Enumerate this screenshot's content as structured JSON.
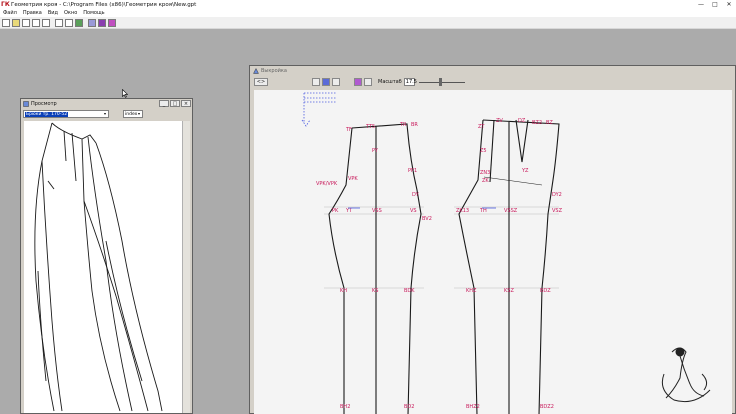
{
  "window": {
    "title": "Геометрия кроя - C:\\Program Files (x86)\\Геометрия кроя\\New.gpt",
    "controls": [
      "—",
      "□",
      "✕"
    ]
  },
  "menu": {
    "items": [
      "Файл",
      "Правка",
      "Вид",
      "Окно",
      "Помощь"
    ]
  },
  "preview": {
    "title": "Просмотр",
    "select_value": "Брюки тр. 170-52",
    "second_value": "index",
    "controls": [
      "_",
      "□",
      "×"
    ]
  },
  "pattern": {
    "title": "Выкройка",
    "nav_label": "<>",
    "zoom_label": "Масштаб",
    "zoom_value": "17.5",
    "zoom_level": 0.45,
    "labels": {
      "front": {
        "top_left": "TF",
        "top_mid": "TT5",
        "top_right": "TR",
        "top_right2": "BR",
        "center_right": "PY",
        "side_right": "PP1",
        "hip_left": "VPK",
        "hip_note": "VPK/VPK",
        "dy": "DY",
        "mid_left": "PK",
        "mid_left2": "YT",
        "mid_center": "VSS",
        "mid_right": "VS",
        "mid_right2": "BV2",
        "knee_left": "KH",
        "knee_center": "KS",
        "knee_right": "BDK",
        "bottom_left": "BH2",
        "bottom_right": "BD2"
      },
      "back": {
        "top_left": "ZT",
        "top_mid1": "ZV",
        "top_mid2": "DZ",
        "top_mid3": "BZ2",
        "top_right": "BZ",
        "mid_label": "Z5",
        "hip_left": "ZN3",
        "yz": "YZ",
        "back_left": "ZK",
        "side_right": "DY2",
        "mid_left": "ZK13",
        "mid_left2": "TH",
        "mid_center": "VSSZ",
        "mid_right": "VSZ",
        "knee_left": "KHZ",
        "knee_center": "KSZ",
        "knee_right": "BDZ",
        "bottom_left": "BHZ2",
        "bottom_right": "BDZ2"
      }
    }
  },
  "colors": {
    "accent": "#c8185a",
    "selection": "#0a3fb8",
    "workspace": "#ababab",
    "chrome": "#d4d0c8"
  },
  "icons": {
    "app": "tk-logo-icon",
    "toolbar": [
      "new-file-icon",
      "open-folder-icon",
      "save-icon",
      "print-icon",
      "print-preview-icon",
      "copy-icon",
      "measure-icon",
      "green-tool-icon",
      "grid-icon",
      "purple-tool-icon",
      "magenta-tool-icon"
    ],
    "pattern_toolbar": [
      "hand-icon",
      "select-icon",
      "text-icon",
      "blue-square-icon",
      "purple-square-icon",
      "ruler-icon"
    ],
    "watermark": "fashion-figure-logo"
  }
}
